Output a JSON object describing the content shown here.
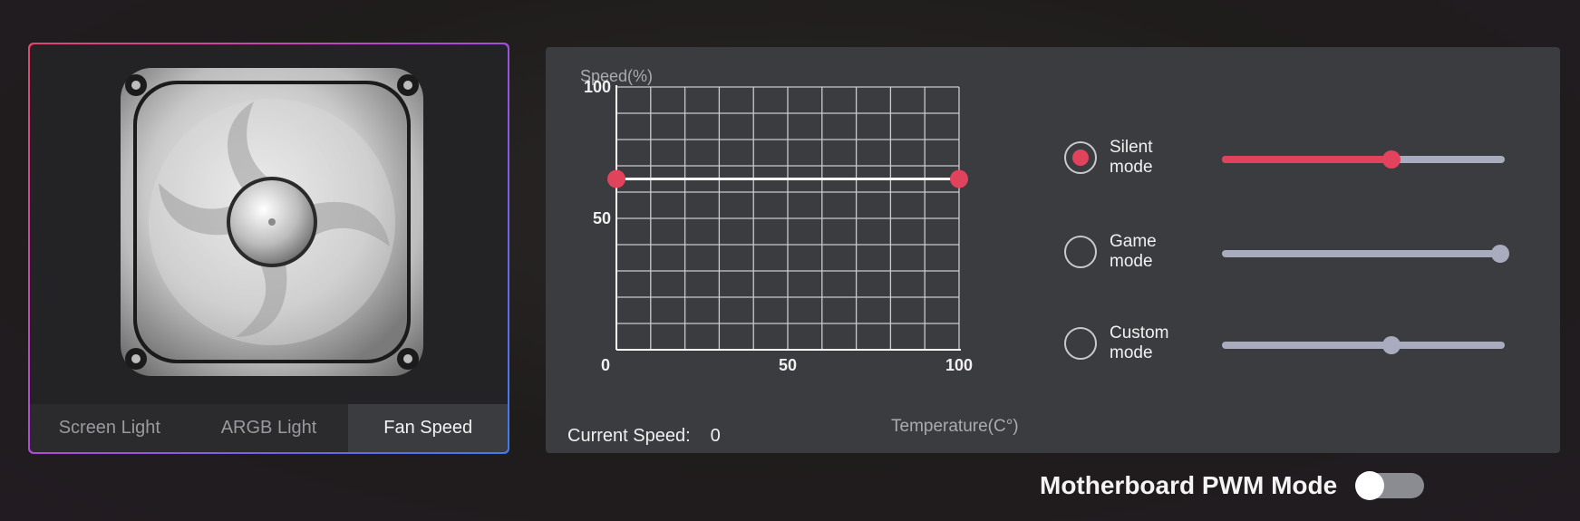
{
  "device": {
    "image_name": "fan-image",
    "tabs": [
      {
        "label": "Screen Light",
        "active": false
      },
      {
        "label": "ARGB Light",
        "active": false
      },
      {
        "label": "Fan Speed",
        "active": true
      }
    ]
  },
  "chart": {
    "speed_axis_label": "Speed(%)",
    "temp_axis_label": "Temperature(C°)",
    "y_ticks": [
      "100",
      "50",
      "0"
    ],
    "x_ticks": [
      "50",
      "100"
    ]
  },
  "chart_data": {
    "type": "line",
    "xlabel": "Temperature(C°)",
    "ylabel": "Speed(%)",
    "xlim": [
      0,
      100
    ],
    "ylim": [
      0,
      100
    ],
    "grid": true,
    "series": [
      {
        "x": [
          0,
          100
        ],
        "y": [
          65,
          65
        ],
        "color": "#ffffff",
        "point_color": "#e0435b"
      }
    ]
  },
  "current_speed": {
    "label": "Current Speed:",
    "value": "0"
  },
  "modes": [
    {
      "line1": "Silent",
      "line2": "mode",
      "checked": true,
      "value": 0.6,
      "active_color": "#e0435b"
    },
    {
      "line1": "Game",
      "line2": "mode",
      "checked": false,
      "value": 0.985
    },
    {
      "line1": "Custom",
      "line2": "mode",
      "checked": false,
      "value": 0.6
    }
  ],
  "pwm": {
    "label": "Motherboard PWM Mode",
    "enabled": false
  },
  "colors": {
    "accent": "#e0435b",
    "track": "#a9abbf",
    "panel": "#3a3c3f"
  }
}
